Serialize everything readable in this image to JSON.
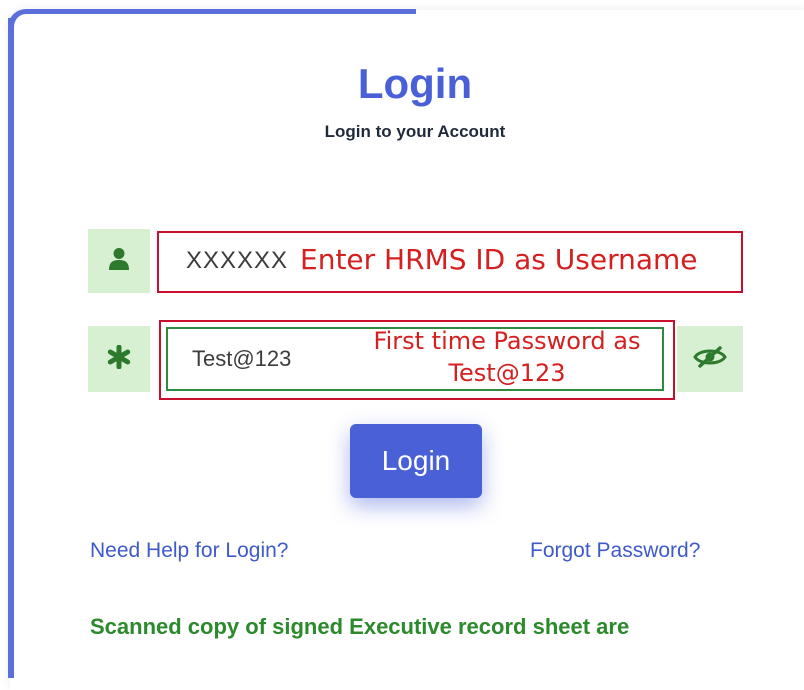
{
  "header": {
    "title": "Login",
    "subtitle": "Login to your Account"
  },
  "username": {
    "value": "XXXXXX",
    "annotation": "Enter HRMS ID as Username",
    "icon": "user-icon"
  },
  "password": {
    "value": "Test@123",
    "annotation": "First time Password as Test@123",
    "icon": "asterisk-icon",
    "toggle_icon": "eye-slash-icon"
  },
  "actions": {
    "login_label": "Login",
    "help_link": "Need Help for Login?",
    "forgot_link": "Forgot Password?"
  },
  "notice": "Scanned copy of signed Executive record sheet are",
  "colors": {
    "brand": "#4a60d6",
    "addon_bg": "#d8f0d2",
    "addon_icon": "#2d7a2d",
    "annotation_red": "#d42020",
    "notice_green": "#2b8a2b",
    "link_blue": "#3f5ac9"
  }
}
